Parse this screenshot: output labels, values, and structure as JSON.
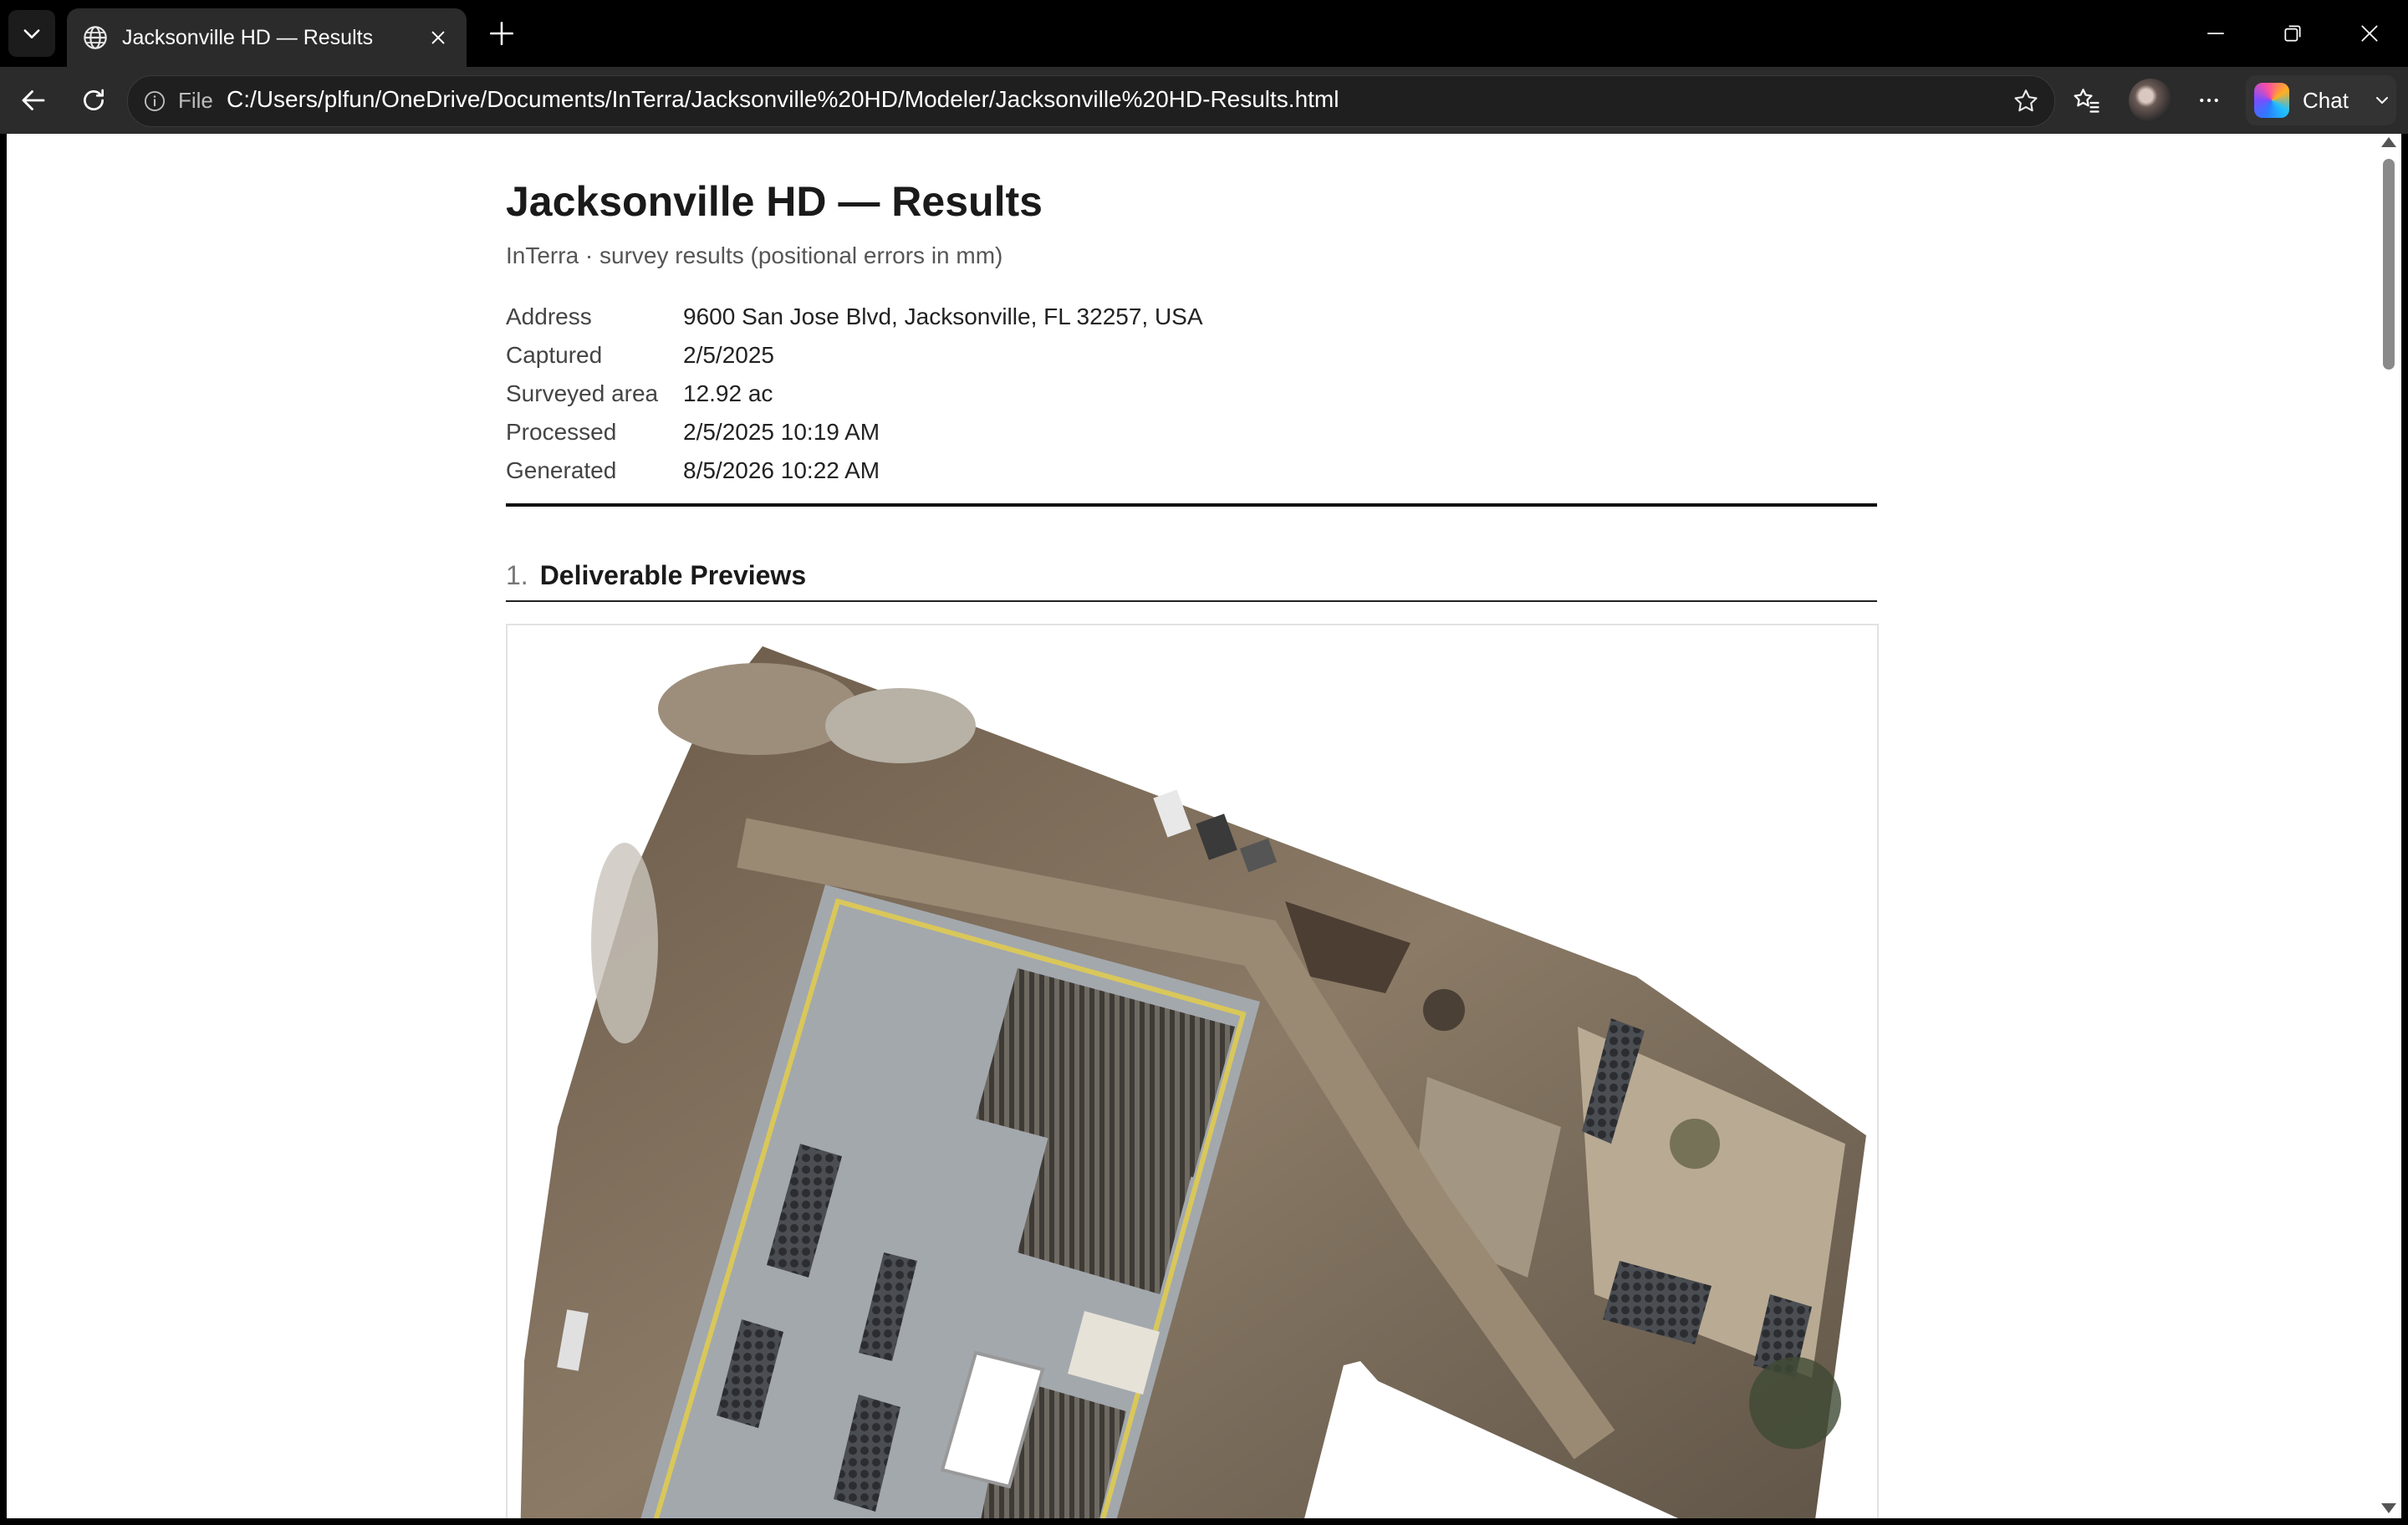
{
  "browser": {
    "tab_title": "Jacksonville HD — Results",
    "address_scheme_label": "File",
    "address_url": "C:/Users/plfun/OneDrive/Documents/InTerra/Jacksonville%20HD/Modeler/Jacksonville%20HD-Results.html",
    "chat_label": "Chat"
  },
  "page": {
    "title": "Jacksonville HD — Results",
    "subtitle": "InTerra · survey results (positional errors in mm)",
    "meta": [
      {
        "label": "Address",
        "value": "9600 San Jose Blvd, Jacksonville, FL 32257, USA"
      },
      {
        "label": "Captured",
        "value": "2/5/2025"
      },
      {
        "label": "Surveyed area",
        "value": "12.92 ac"
      },
      {
        "label": "Processed",
        "value": "2/5/2025 10:19 AM"
      },
      {
        "label": "Generated",
        "value": "8/5/2026 10:22 AM"
      }
    ],
    "section": {
      "number": "1.",
      "title": "Deliverable Previews"
    }
  },
  "icons": {
    "tab_menu": "chevron-down-icon",
    "tab_site": "globe-icon",
    "tab_close": "close-icon",
    "new_tab": "plus-icon",
    "minimize": "minimize-icon",
    "restore": "restore-icon",
    "close_window": "close-icon",
    "back": "back-arrow-icon",
    "refresh": "refresh-icon",
    "info": "info-icon",
    "favorite": "star-icon",
    "favorites": "favorites-icon",
    "more": "more-icon"
  }
}
